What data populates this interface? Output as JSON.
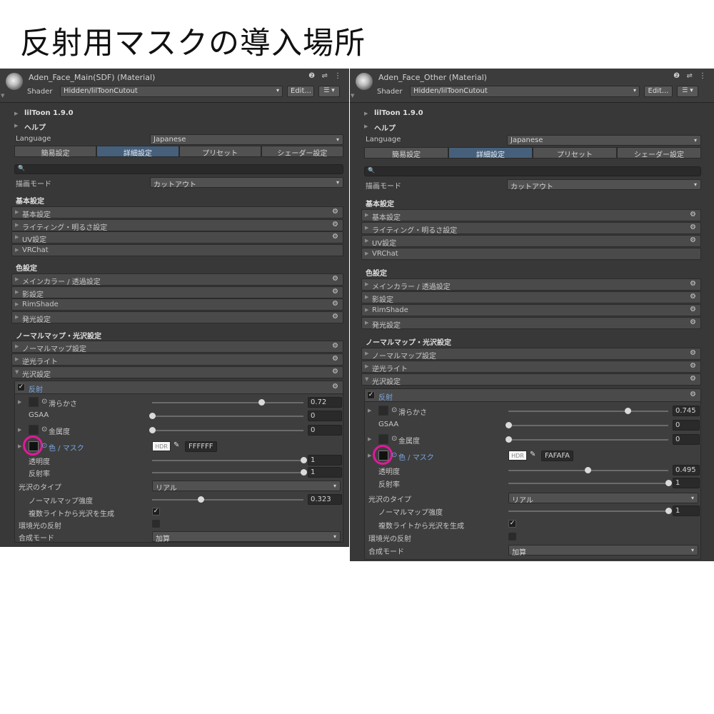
{
  "heading": "反射用マスクの導入場所",
  "common": {
    "gear_glyph": "⚙",
    "triangle_right": "▶",
    "triangle_down": "▼",
    "check_glyph": "✓",
    "dropdown_arrow": "▾",
    "search_glyph": "🔍",
    "pipette_glyph": "✎",
    "radio_glyph": "⊙"
  },
  "left": {
    "material_title": "Aden_Face_Main(SDF) (Material)",
    "header_icons": "❷ ⇌ ⋮",
    "shader_label": "Shader",
    "shader_value": "Hidden/lilToonCutout",
    "edit_label": "Edit...",
    "list_label": "☰ ▾",
    "version": "lilToon 1.9.0",
    "help": "ヘルプ",
    "language_label": "Language",
    "language_value": "Japanese",
    "tabs": [
      "簡易設定",
      "詳細設定",
      "プリセット",
      "シェーダー設定"
    ],
    "render_mode_label": "描画モード",
    "render_mode_value": "カットアウト",
    "sec_basic": "基本設定",
    "basic_items": [
      "基本設定",
      "ライティング・明るさ設定",
      "UV設定",
      "VRChat"
    ],
    "sec_color": "色設定",
    "color_items": [
      "メインカラー / 透過設定",
      "影設定",
      "RimShade",
      "発光設定"
    ],
    "sec_normal": "ノーマルマップ・光沢設定",
    "normal_items": [
      "ノーマルマップ設定",
      "逆光ライト",
      "光沢設定"
    ],
    "reflection_label": "反射",
    "smoothness_label": "滑らかさ",
    "smoothness_value": "0.72",
    "smoothness_frac": 0.72,
    "gsaa_label": "GSAA",
    "gsaa_value": "0",
    "gsaa_frac": 0,
    "metallic_label": "金属度",
    "metallic_value": "0",
    "metallic_frac": 0,
    "color_mask_label": "色 / マスク",
    "hdr_label": "HDR",
    "hex_value": "FFFFFF",
    "transparency_label": "透明度",
    "transparency_value": "1",
    "transparency_frac": 1,
    "reflectance_label": "反射率",
    "reflectance_value": "1",
    "reflectance_frac": 1,
    "gloss_type_label": "光沢のタイプ",
    "gloss_type_value": "リアル",
    "normal_strength_label": "ノーマルマップ強度",
    "normal_strength_value": "0.323",
    "normal_strength_frac": 0.323,
    "multi_light_label": "複数ライトから光沢を生成",
    "ambient_label": "環境光の反射",
    "blend_label": "合成モード",
    "blend_value": "加算"
  },
  "right": {
    "material_title": "Aden_Face_Other (Material)",
    "header_icons": "❷ ⇌ ⋮",
    "shader_label": "Shader",
    "shader_value": "Hidden/lilToonCutout",
    "edit_label": "Edit...",
    "list_label": "☰ ▾",
    "version": "lilToon 1.9.0",
    "help": "ヘルプ",
    "language_label": "Language",
    "language_value": "Japanese",
    "tabs": [
      "簡易設定",
      "詳細設定",
      "プリセット",
      "シェーダー設定"
    ],
    "render_mode_label": "描画モード",
    "render_mode_value": "カットアウト",
    "sec_basic": "基本設定",
    "basic_items": [
      "基本設定",
      "ライティング・明るさ設定",
      "UV設定",
      "VRChat"
    ],
    "sec_color": "色設定",
    "color_items": [
      "メインカラー / 透過設定",
      "影設定",
      "RimShade",
      "発光設定"
    ],
    "sec_normal": "ノーマルマップ・光沢設定",
    "normal_items": [
      "ノーマルマップ設定",
      "逆光ライト",
      "光沢設定"
    ],
    "reflection_label": "反射",
    "smoothness_label": "滑らかさ",
    "smoothness_value": "0.745",
    "smoothness_frac": 0.745,
    "gsaa_label": "GSAA",
    "gsaa_value": "0",
    "gsaa_frac": 0,
    "metallic_label": "金属度",
    "metallic_value": "0",
    "metallic_frac": 0,
    "color_mask_label": "色 / マスク",
    "hdr_label": "HDR",
    "hex_value": "FAFAFA",
    "transparency_label": "透明度",
    "transparency_value": "0.495",
    "transparency_frac": 0.495,
    "reflectance_label": "反射率",
    "reflectance_value": "1",
    "reflectance_frac": 1,
    "gloss_type_label": "光沢のタイプ",
    "gloss_type_value": "リアル",
    "normal_strength_label": "ノーマルマップ強度",
    "normal_strength_value": "1",
    "normal_strength_frac": 1,
    "multi_light_label": "複数ライトから光沢を生成",
    "ambient_label": "環境光の反射",
    "blend_label": "合成モード",
    "blend_value": "加算"
  },
  "colors": {
    "panel_bg": "#383838",
    "active_tab": "#46607c",
    "highlight_circle": "#e0199c",
    "link_blue": "#7aa6e0"
  }
}
